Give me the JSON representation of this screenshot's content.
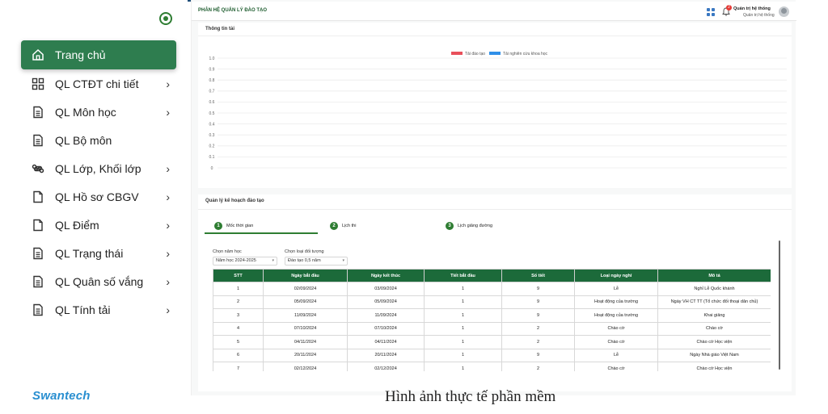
{
  "sidebar": {
    "items": [
      {
        "label": "Trang chủ",
        "icon": "home-icon",
        "active": true,
        "chevron": false
      },
      {
        "label": "QL CTĐT chi tiết",
        "icon": "grid-dashboard-icon",
        "active": false,
        "chevron": true
      },
      {
        "label": "QL Môn học",
        "icon": "document-icon",
        "active": false,
        "chevron": true
      },
      {
        "label": "QL Bộ môn",
        "icon": "document-icon",
        "active": false,
        "chevron": false
      },
      {
        "label": "QL Lớp, Khối lớp",
        "icon": "command-icon",
        "active": false,
        "chevron": true
      },
      {
        "label": "QL Hồ sơ CBGV",
        "icon": "file-icon",
        "active": false,
        "chevron": true
      },
      {
        "label": "QL Điểm",
        "icon": "file-icon",
        "active": false,
        "chevron": true
      },
      {
        "label": "QL Trạng thái",
        "icon": "document-icon",
        "active": false,
        "chevron": true
      },
      {
        "label": "QL Quân số vắng",
        "icon": "document-icon",
        "active": false,
        "chevron": true
      },
      {
        "label": "QL Tính tải",
        "icon": "document-icon",
        "active": false,
        "chevron": true
      }
    ],
    "chevron_glyph": "›",
    "logo": "Swantech"
  },
  "header": {
    "title": "PHÂN HỆ QUẢN LÝ ĐÀO TẠO",
    "notification_count": "2",
    "user_name": "Quản trị hệ thống",
    "user_role": "Quản trị hệ thống"
  },
  "load_card": {
    "title": "Thông tin tải"
  },
  "chart_data": {
    "type": "bar",
    "categories": [],
    "series": [
      {
        "name": "Tải đào tạo",
        "color": "#e8505b",
        "values": []
      },
      {
        "name": "Tải nghiên cứu khoa học",
        "color": "#2f8fe8",
        "values": []
      }
    ],
    "ylim": [
      0,
      1.0
    ],
    "yticks": [
      "1.0",
      "0.9",
      "0.8",
      "0.7",
      "0.6",
      "0.5",
      "0.4",
      "0.3",
      "0.2",
      "0.1",
      "0"
    ],
    "legend": "top-center",
    "grid": true
  },
  "plan_card": {
    "title": "Quản lý kế hoạch đào tạo",
    "tabs": [
      {
        "num": "1",
        "label": "Mốc thời gian"
      },
      {
        "num": "2",
        "label": "Lịch thi"
      },
      {
        "num": "3",
        "label": "Lịch giảng đường"
      }
    ],
    "filters": {
      "year_label": "Chọn năm học",
      "year_value": "Năm học 2024-2025",
      "type_label": "Chọn loại đối tượng",
      "type_value": "Đào tạo 0,5 năm"
    },
    "table": {
      "headers": [
        "STT",
        "Ngày bắt đầu",
        "Ngày kết thúc",
        "Tiết bắt đầu",
        "Số tiết",
        "Loại ngày nghỉ",
        "Mô tả"
      ],
      "rows": [
        [
          "1",
          "02/09/2024",
          "03/09/2024",
          "1",
          "9",
          "Lễ",
          "Nghỉ Lễ Quốc khánh"
        ],
        [
          "2",
          "05/09/2024",
          "05/09/2024",
          "1",
          "9",
          "Hoạt động của trường",
          "Ngày VH CT TT (Tổ chức đối thoại dân chủ)"
        ],
        [
          "3",
          "11/09/2024",
          "11/09/2024",
          "1",
          "9",
          "Hoạt động của trường",
          "Khai giảng"
        ],
        [
          "4",
          "07/10/2024",
          "07/10/2024",
          "1",
          "2",
          "Chào cờ",
          "Chào cờ"
        ],
        [
          "5",
          "04/11/2024",
          "04/11/2024",
          "1",
          "2",
          "Chào cờ",
          "Chào cờ Học viện"
        ],
        [
          "6",
          "20/11/2024",
          "20/11/2024",
          "1",
          "9",
          "Lễ",
          "Ngày Nhà giáo Việt Nam"
        ],
        [
          "7",
          "02/12/2024",
          "02/12/2024",
          "1",
          "2",
          "Chào cờ",
          "Chào cờ Học viện"
        ]
      ]
    }
  },
  "caption": "Hình ảnh thực tế phần mềm"
}
